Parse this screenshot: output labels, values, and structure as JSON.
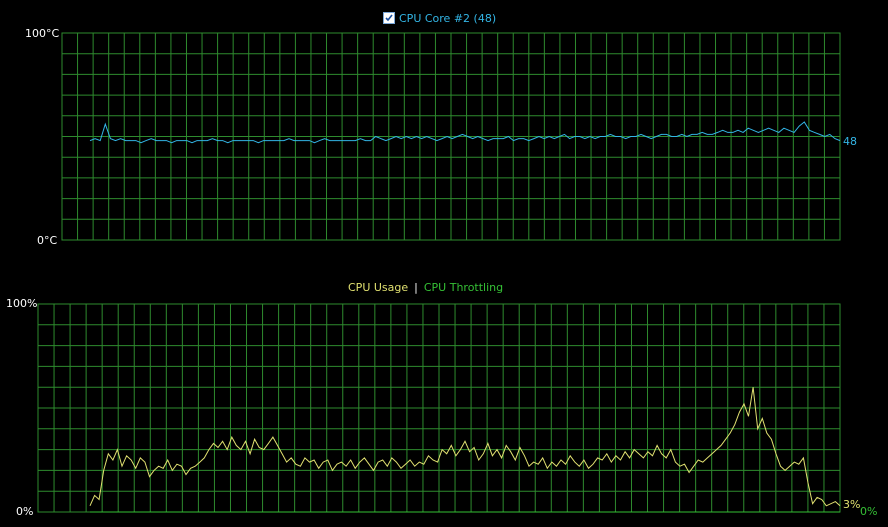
{
  "top_panel": {
    "checkbox_checked": true,
    "series_title": "CPU Core #2 (48)",
    "y_max_label": "100°C",
    "y_min_label": "0°C",
    "current_value_label": "48",
    "series_color": "#33b5e5"
  },
  "bottom_panel": {
    "legend_usage": "CPU Usage",
    "legend_separator": "|",
    "legend_throttling": "CPU Throttling",
    "y_max_label": "100%",
    "y_min_label": "0%",
    "usage_value_label": "3%",
    "throttling_value_label": "0%",
    "usage_color": "#e0e070",
    "throttling_color": "#35c035"
  },
  "grid_color": "#2e8b2e",
  "chart_data": [
    {
      "type": "line",
      "title": "CPU Core #2 (48)",
      "ylabel": "°C",
      "ylim": [
        0,
        100
      ],
      "grid": true,
      "series": [
        {
          "name": "CPU Core #2 (48)",
          "values": [
            48,
            49,
            48,
            56,
            49,
            48,
            49,
            48,
            48,
            48,
            47,
            48,
            49,
            48,
            48,
            48,
            47,
            48,
            48,
            48,
            47,
            48,
            48,
            48,
            49,
            48,
            48,
            47,
            48,
            48,
            48,
            48,
            48,
            47,
            48,
            48,
            48,
            48,
            48,
            49,
            48,
            48,
            48,
            48,
            47,
            48,
            49,
            48,
            48,
            48,
            48,
            48,
            48,
            49,
            48,
            48,
            50,
            49,
            48,
            49,
            50,
            49,
            50,
            49,
            50,
            49,
            50,
            49,
            48,
            49,
            50,
            49,
            50,
            51,
            50,
            49,
            50,
            49,
            48,
            49,
            49,
            49,
            50,
            48,
            49,
            49,
            48,
            49,
            50,
            49,
            50,
            49,
            50,
            51,
            49,
            50,
            50,
            49,
            50,
            49,
            50,
            50,
            51,
            50,
            50,
            49,
            50,
            50,
            51,
            50,
            49,
            50,
            51,
            51,
            50,
            50,
            51,
            50,
            51,
            51,
            52,
            51,
            51,
            52,
            53,
            52,
            52,
            53,
            52,
            54,
            53,
            52,
            53,
            54,
            53,
            52,
            54,
            53,
            52,
            55,
            57,
            53,
            52,
            51,
            50,
            51,
            49,
            48
          ]
        }
      ]
    },
    {
      "type": "line",
      "title": "",
      "ylabel": "%",
      "ylim": [
        0,
        100
      ],
      "grid": true,
      "series": [
        {
          "name": "CPU Usage",
          "values": [
            3,
            8,
            6,
            20,
            28,
            25,
            30,
            22,
            27,
            25,
            21,
            26,
            24,
            17,
            20,
            22,
            21,
            25,
            20,
            23,
            22,
            18,
            21,
            22,
            24,
            26,
            30,
            33,
            31,
            34,
            30,
            36,
            32,
            30,
            34,
            28,
            35,
            31,
            30,
            33,
            36,
            32,
            28,
            24,
            26,
            23,
            22,
            26,
            24,
            25,
            21,
            24,
            25,
            20,
            23,
            24,
            22,
            25,
            21,
            24,
            26,
            23,
            20,
            24,
            25,
            22,
            26,
            24,
            21,
            23,
            25,
            22,
            24,
            23,
            27,
            25,
            24,
            30,
            28,
            32,
            27,
            30,
            34,
            29,
            31,
            25,
            28,
            33,
            27,
            30,
            26,
            32,
            29,
            25,
            31,
            27,
            22,
            24,
            23,
            26,
            21,
            24,
            22,
            25,
            23,
            27,
            24,
            22,
            25,
            21,
            23,
            26,
            25,
            28,
            24,
            27,
            25,
            29,
            26,
            30,
            28,
            26,
            29,
            27,
            32,
            28,
            26,
            30,
            24,
            22,
            23,
            19,
            22,
            25,
            24,
            26,
            28,
            30,
            32,
            35,
            38,
            42,
            48,
            52,
            46,
            60,
            40,
            45,
            38,
            35,
            28,
            22,
            20,
            22,
            24,
            23,
            26,
            14,
            4,
            7,
            6,
            3,
            4,
            5,
            3
          ]
        },
        {
          "name": "CPU Throttling",
          "values": [
            0,
            0,
            0,
            0,
            0,
            0,
            0,
            0,
            0,
            0,
            0,
            0,
            0,
            0,
            0,
            0,
            0,
            0,
            0,
            0,
            0,
            0,
            0,
            0,
            0,
            0,
            0,
            0,
            0,
            0,
            0,
            0,
            0,
            0,
            0,
            0,
            0,
            0,
            0,
            0,
            0,
            0,
            0,
            0,
            0,
            0,
            0,
            0,
            0,
            0,
            0,
            0,
            0,
            0,
            0,
            0,
            0,
            0,
            0,
            0,
            0,
            0,
            0,
            0,
            0,
            0,
            0,
            0,
            0,
            0,
            0,
            0,
            0,
            0,
            0,
            0,
            0,
            0,
            0,
            0,
            0,
            0,
            0,
            0,
            0,
            0,
            0,
            0,
            0,
            0,
            0,
            0,
            0,
            0,
            0,
            0,
            0,
            0,
            0,
            0,
            0,
            0,
            0,
            0,
            0,
            0,
            0,
            0,
            0,
            0,
            0,
            0,
            0,
            0,
            0,
            0,
            0,
            0,
            0,
            0,
            0,
            0,
            0,
            0,
            0,
            0,
            0,
            0,
            0,
            0,
            0,
            0,
            0,
            0,
            0,
            0,
            0,
            0,
            0,
            0,
            0,
            0,
            0,
            0,
            0,
            0,
            0,
            0,
            0,
            0,
            0,
            0,
            0,
            0,
            0,
            0,
            0,
            0,
            0,
            0,
            0,
            0,
            0,
            0,
            0
          ]
        }
      ]
    }
  ]
}
